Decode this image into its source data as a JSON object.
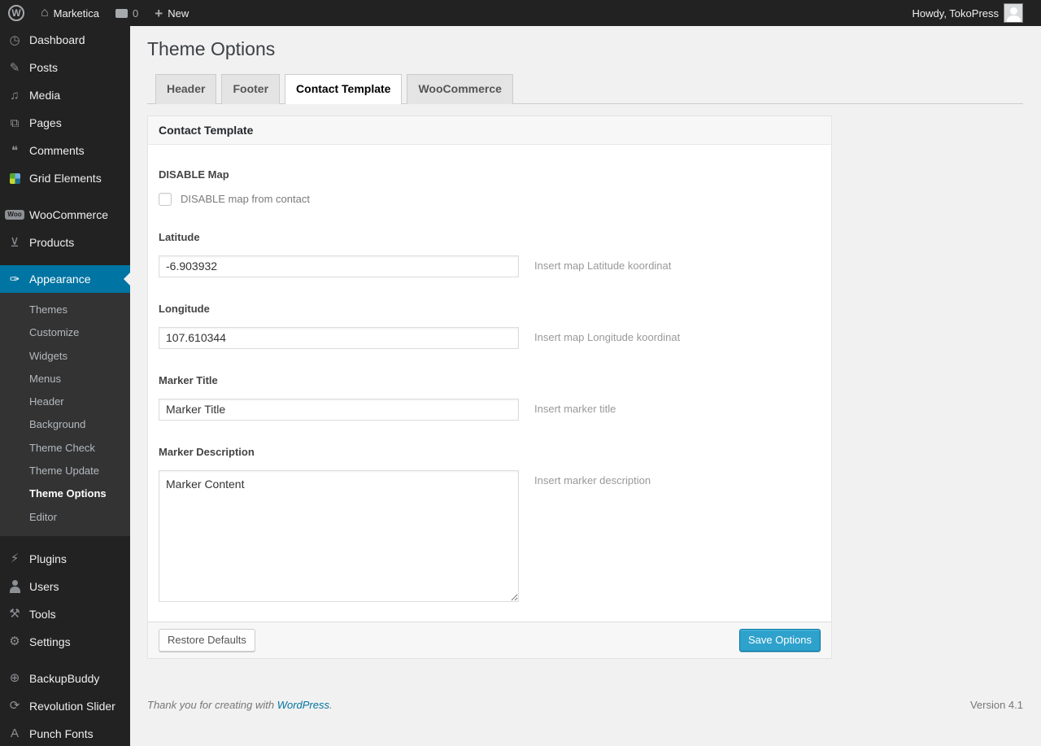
{
  "admin_bar": {
    "site_name": "Marketica",
    "comments_count": "0",
    "new_label": "New",
    "howdy": "Howdy, TokoPress"
  },
  "sidebar": {
    "items": [
      {
        "label": "Dashboard",
        "icon": "dashboard",
        "glyph": "◷"
      },
      {
        "label": "Posts",
        "icon": "posts",
        "glyph": "✎"
      },
      {
        "label": "Media",
        "icon": "media",
        "glyph": "♫"
      },
      {
        "label": "Pages",
        "icon": "pages",
        "glyph": "⧉"
      },
      {
        "label": "Comments",
        "icon": "comments",
        "glyph": "❝"
      },
      {
        "label": "Grid Elements",
        "icon": "grid-elements",
        "glyph": ""
      },
      {
        "label": "WooCommerce",
        "icon": "woocommerce",
        "glyph": "Woo",
        "gap_before": true
      },
      {
        "label": "Products",
        "icon": "products",
        "glyph": "⊻"
      },
      {
        "label": "Appearance",
        "icon": "appearance",
        "glyph": "✑",
        "active": true,
        "gap_before": true,
        "submenu": [
          "Themes",
          "Customize",
          "Widgets",
          "Menus",
          "Header",
          "Background",
          "Theme Check",
          "Theme Update",
          "Theme Options",
          "Editor"
        ],
        "submenu_current": "Theme Options"
      },
      {
        "label": "Plugins",
        "icon": "plugins",
        "glyph": "⚡",
        "gap_before": true
      },
      {
        "label": "Users",
        "icon": "users",
        "glyph": ""
      },
      {
        "label": "Tools",
        "icon": "tools",
        "glyph": "⚒"
      },
      {
        "label": "Settings",
        "icon": "settings",
        "glyph": "⚙"
      },
      {
        "label": "BackupBuddy",
        "icon": "backupbuddy",
        "glyph": "⊕",
        "gap_before": true
      },
      {
        "label": "Revolution Slider",
        "icon": "revolution-slider",
        "glyph": "⟳"
      },
      {
        "label": "Punch Fonts",
        "icon": "punch-fonts",
        "glyph": "A"
      }
    ]
  },
  "page": {
    "title": "Theme Options",
    "tabs": [
      {
        "label": "Header",
        "active": false
      },
      {
        "label": "Footer",
        "active": false
      },
      {
        "label": "Contact Template",
        "active": true
      },
      {
        "label": "WooCommerce",
        "active": false
      }
    ],
    "panel": {
      "title": "Contact Template",
      "fields": {
        "disable_map": {
          "label": "DISABLE Map",
          "checkbox_label": "DISABLE map from contact",
          "checked": false
        },
        "latitude": {
          "label": "Latitude",
          "value": "-6.903932",
          "hint": "Insert map Latitude koordinat"
        },
        "longitude": {
          "label": "Longitude",
          "value": "107.610344",
          "hint": "Insert map Longitude koordinat"
        },
        "marker_title": {
          "label": "Marker Title",
          "value": "Marker Title",
          "hint": "Insert marker title"
        },
        "marker_description": {
          "label": "Marker Description",
          "value": "Marker Content",
          "hint": "Insert marker description"
        }
      },
      "restore_button": "Restore Defaults",
      "save_button": "Save Options"
    },
    "footer": {
      "thanks_prefix": "Thank you for creating with ",
      "wordpress_link": "WordPress",
      "thanks_suffix": ".",
      "version": "Version 4.1"
    }
  },
  "colors": {
    "accent": "#0074a2",
    "primary_button": "#2ea2cc",
    "admin_bar": "#222222",
    "submenu_bg": "#333333"
  }
}
